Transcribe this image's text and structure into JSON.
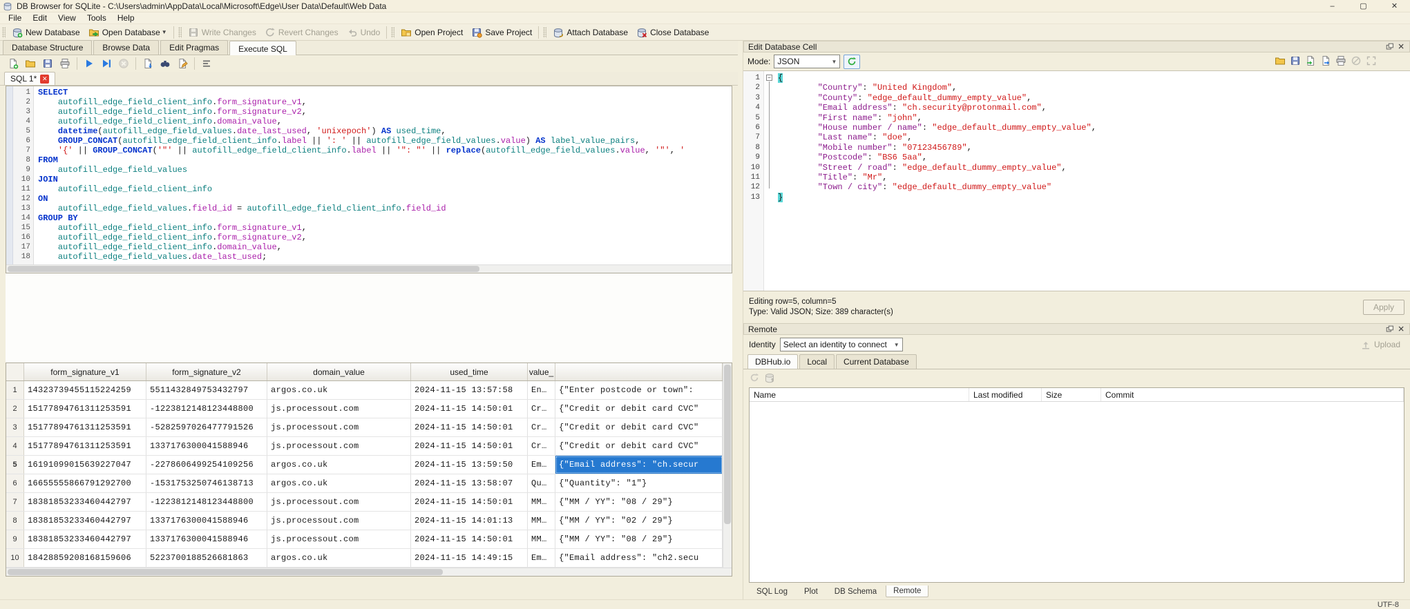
{
  "window": {
    "title": "DB Browser for SQLite - C:\\Users\\admin\\AppData\\Local\\Microsoft\\Edge\\User Data\\Default\\Web Data",
    "minimize": "–",
    "maximize": "▢",
    "close": "✕",
    "encoding": "UTF-8"
  },
  "menu": [
    "File",
    "Edit",
    "View",
    "Tools",
    "Help"
  ],
  "toolbar": {
    "groups": [
      {
        "items": [
          {
            "label": "New Database",
            "icon": "new-database-icon",
            "enabled": true
          },
          {
            "label": "Open Database",
            "icon": "open-database-icon",
            "enabled": true,
            "dropdown": true
          }
        ]
      },
      {
        "items": [
          {
            "label": "Write Changes",
            "icon": "write-changes-icon",
            "enabled": false
          },
          {
            "label": "Revert Changes",
            "icon": "revert-changes-icon",
            "enabled": false
          },
          {
            "label": "Undo",
            "icon": "undo-icon",
            "enabled": false
          }
        ]
      },
      {
        "items": [
          {
            "label": "Open Project",
            "icon": "open-project-icon",
            "enabled": true
          },
          {
            "label": "Save Project",
            "icon": "save-project-icon",
            "enabled": true
          }
        ]
      },
      {
        "items": [
          {
            "label": "Attach Database",
            "icon": "attach-database-icon",
            "enabled": true
          },
          {
            "label": "Close Database",
            "icon": "close-database-icon",
            "enabled": true
          }
        ]
      }
    ]
  },
  "main_tabs": {
    "items": [
      "Database Structure",
      "Browse Data",
      "Edit Pragmas",
      "Execute SQL"
    ],
    "active": 3
  },
  "sql_toolbar": {
    "items": [
      {
        "icon": "new-sql-tab-icon",
        "enabled": true
      },
      {
        "icon": "open-sql-file-icon",
        "enabled": true
      },
      {
        "icon": "save-sql-file-icon",
        "enabled": true
      },
      {
        "icon": "print-icon",
        "enabled": true
      },
      {
        "icon": "execute-all-icon",
        "enabled": true,
        "sep": true
      },
      {
        "icon": "execute-current-icon",
        "enabled": true
      },
      {
        "icon": "stop-icon",
        "enabled": false
      },
      {
        "icon": "save-results-icon",
        "enabled": true,
        "sep": true
      },
      {
        "icon": "find-icon",
        "enabled": true
      },
      {
        "icon": "edit-icon",
        "enabled": true
      },
      {
        "icon": "format-icon",
        "enabled": true,
        "sep": true
      }
    ]
  },
  "sql_tab": {
    "label": "SQL 1*",
    "close": "✕"
  },
  "sql_editor": {
    "lines": [
      "SELECT",
      "    autofill_edge_field_client_info.form_signature_v1,",
      "    autofill_edge_field_client_info.form_signature_v2,",
      "    autofill_edge_field_client_info.domain_value,",
      "    datetime(autofill_edge_field_values.date_last_used, 'unixepoch') AS used_time,",
      "    GROUP_CONCAT(autofill_edge_field_client_info.label || ': ' || autofill_edge_field_values.value) AS label_value_pairs,",
      "    '{' || GROUP_CONCAT('\"' || autofill_edge_field_client_info.label || '\": \"' || replace(autofill_edge_field_values.value, '\"', '",
      "FROM",
      "    autofill_edge_field_values",
      "JOIN",
      "    autofill_edge_field_client_info",
      "ON",
      "    autofill_edge_field_values.field_id = autofill_edge_field_client_info.field_id",
      "GROUP BY",
      "    autofill_edge_field_client_info.form_signature_v1,",
      "    autofill_edge_field_client_info.form_signature_v2,",
      "    autofill_edge_field_client_info.domain_value,",
      "    autofill_edge_field_values.date_last_used;"
    ]
  },
  "results": {
    "columns": [
      "form_signature_v1",
      "form_signature_v2",
      "domain_value",
      "used_time",
      "value_",
      ""
    ],
    "selected_row": 5,
    "rows": [
      [
        "1",
        "14323739455115224259",
        "5511432849753432797",
        "argos.co.uk",
        "2024-11-15 13:57:58",
        "En…",
        "{\"Enter postcode or town\":"
      ],
      [
        "2",
        "15177894761311253591",
        "-1223812148123448800",
        "js.processout.com",
        "2024-11-15 14:50:01",
        "Cr…",
        "{\"Credit or debit card CVC\""
      ],
      [
        "3",
        "15177894761311253591",
        "-5282597026477791526",
        "js.processout.com",
        "2024-11-15 14:50:01",
        "Cr…",
        "{\"Credit or debit card CVC\""
      ],
      [
        "4",
        "15177894761311253591",
        "1337176300041588946",
        "js.processout.com",
        "2024-11-15 14:50:01",
        "Cr…",
        "{\"Credit or debit card CVC\""
      ],
      [
        "5",
        "16191099015639227047",
        "-2278606499254109256",
        "argos.co.uk",
        "2024-11-15 13:59:50",
        "Em…",
        "{\"Email address\": \"ch.secur"
      ],
      [
        "6",
        "16655555866791292700",
        "-1531753250746138713",
        "argos.co.uk",
        "2024-11-15 13:58:07",
        "Qu…",
        "{\"Quantity\": \"1\"}"
      ],
      [
        "7",
        "18381853233460442797",
        "-1223812148123448800",
        "js.processout.com",
        "2024-11-15 14:50:01",
        "MM…",
        "{\"MM / YY\": \"08 / 29\"}"
      ],
      [
        "8",
        "18381853233460442797",
        "1337176300041588946",
        "js.processout.com",
        "2024-11-15 14:01:13",
        "MM…",
        "{\"MM / YY\": \"02 / 29\"}"
      ],
      [
        "9",
        "18381853233460442797",
        "1337176300041588946",
        "js.processout.com",
        "2024-11-15 14:50:01",
        "MM…",
        "{\"MM / YY\": \"08 / 29\"}"
      ],
      [
        "10",
        "18428859208168159606",
        "5223700188526681863",
        "argos.co.uk",
        "2024-11-15 14:49:15",
        "Em…",
        "{\"Email address\": \"ch2.secu"
      ]
    ]
  },
  "cell_editor": {
    "title": "Edit Database Cell",
    "mode_label": "Mode:",
    "mode_value": "JSON",
    "json_lines": [
      "{",
      "        \"Country\": \"United Kingdom\",",
      "        \"County\": \"edge_default_dummy_empty_value\",",
      "        \"Email address\": \"ch.security@protonmail.com\",",
      "        \"First name\": \"john\",",
      "        \"House number / name\": \"edge_default_dummy_empty_value\",",
      "        \"Last name\": \"doe\",",
      "        \"Mobile number\": \"07123456789\",",
      "        \"Postcode\": \"BS6 5aa\",",
      "        \"Street / road\": \"edge_default_dummy_empty_value\",",
      "        \"Title\": \"Mr\",",
      "        \"Town / city\": \"edge_default_dummy_empty_value\"",
      "}"
    ],
    "status_line1": "Editing row=5, column=5",
    "status_line2": "Type: Valid JSON; Size: 389 character(s)",
    "apply_label": "Apply"
  },
  "remote": {
    "title": "Remote",
    "identity_label": "Identity",
    "identity_value": "Select an identity to connect",
    "upload_label": "Upload",
    "tabs": {
      "items": [
        "DBHub.io",
        "Local",
        "Current Database"
      ],
      "active": 0
    },
    "table_columns": [
      "Name",
      "Last modified",
      "Size",
      "Commit"
    ]
  },
  "dock_tabs": {
    "items": [
      "SQL Log",
      "Plot",
      "DB Schema",
      "Remote"
    ],
    "active": 3
  }
}
